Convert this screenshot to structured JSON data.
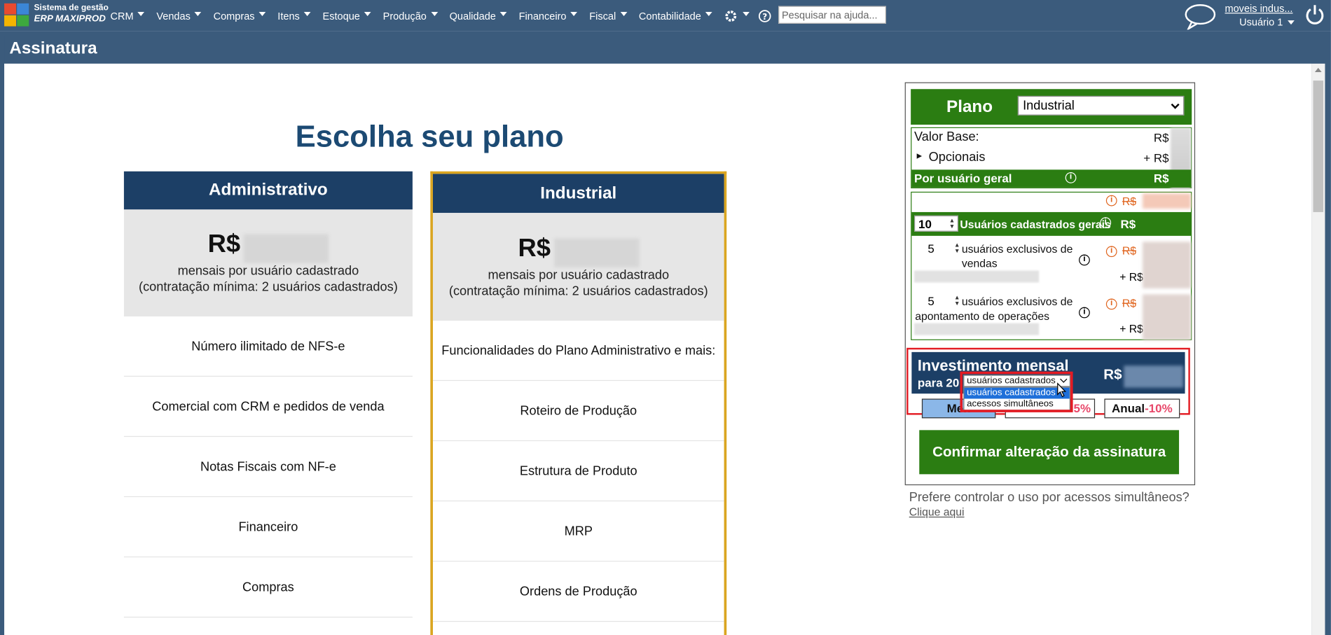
{
  "nav": {
    "brand_line1": "Sistema de gestão",
    "brand_line2": "ERP MAXIPROD",
    "menu": [
      "CRM",
      "Vendas",
      "Compras",
      "Itens",
      "Estoque",
      "Produção",
      "Qualidade",
      "Financeiro",
      "Fiscal",
      "Contabilidade"
    ],
    "search_placeholder": "Pesquisar na ajuda...",
    "company": "moveis indus...",
    "user": "Usuário 1",
    "icons": [
      "gear-icon",
      "help-icon",
      "chat-icon",
      "power-icon"
    ]
  },
  "page": {
    "title": "Assinatura",
    "heading": "Escolha seu plano"
  },
  "plans": [
    {
      "name": "Administrativo",
      "currency": "R$",
      "price_sub1": "mensais por usuário cadastrado",
      "price_sub2": "(contratação mínima: 2 usuários cadastrados)",
      "features": [
        "Número ilimitado de NFS-e",
        "Comercial com CRM e pedidos de venda",
        "Notas Fiscais com NF-e",
        "Financeiro",
        "Compras"
      ]
    },
    {
      "name": "Industrial",
      "currency": "R$",
      "price_sub1": "mensais por usuário cadastrado",
      "price_sub2": "(contratação mínima: 2 usuários cadastrados)",
      "features": [
        "Funcionalidades do Plano Administrativo e mais:",
        "Roteiro de Produção",
        "Estrutura de Produto",
        "MRP",
        "Ordens de Produção"
      ]
    }
  ],
  "panel": {
    "plan_label": "Plano",
    "plan_selected": "Industrial",
    "valor_base": "Valor Base:",
    "valor_base_rs": "R$",
    "opcionais": "Opcionais",
    "opcionais_rs": "+ R$",
    "por_usuario": "Por usuário geral",
    "por_usuario_rs": "R$",
    "strike_rs": "R$",
    "general_users_value": "10",
    "general_users_label": "Usuários cadastrados gerais",
    "general_users_rs": "R$",
    "sales_users_value": "5",
    "sales_users_label": "usuários exclusivos de vendas",
    "sales_strike_rs": "R$",
    "sales_plus_rs": "+ R$",
    "ops_users_value": "5",
    "ops_users_label": "usuários exclusivos de apontamento de operações",
    "ops_strike_rs": "R$",
    "ops_plus_rs": "+ R$",
    "invest_title": "Investimento mensal",
    "invest_sub": "para 20",
    "invest_rs": "R$",
    "mode_selected": "usuários cadastrados",
    "mode_options": [
      "usuários cadastrados",
      "acessos simultâneos"
    ],
    "btn_mensal": "Men",
    "btn_semestral_disc": "5%",
    "btn_anual": "Anual",
    "btn_anual_disc": "-10%",
    "confirm": "Confirmar alteração da assinatura",
    "prefer": "Prefere controlar o uso por acessos simultâneos?",
    "clique": "Clique aqui"
  },
  "colors": {
    "nav": "#3b5b7c",
    "card_header": "#1c3f66",
    "green": "#2b7d12",
    "highlight_border": "#daa520",
    "red": "#e31b23",
    "discount": "#e8486a"
  }
}
